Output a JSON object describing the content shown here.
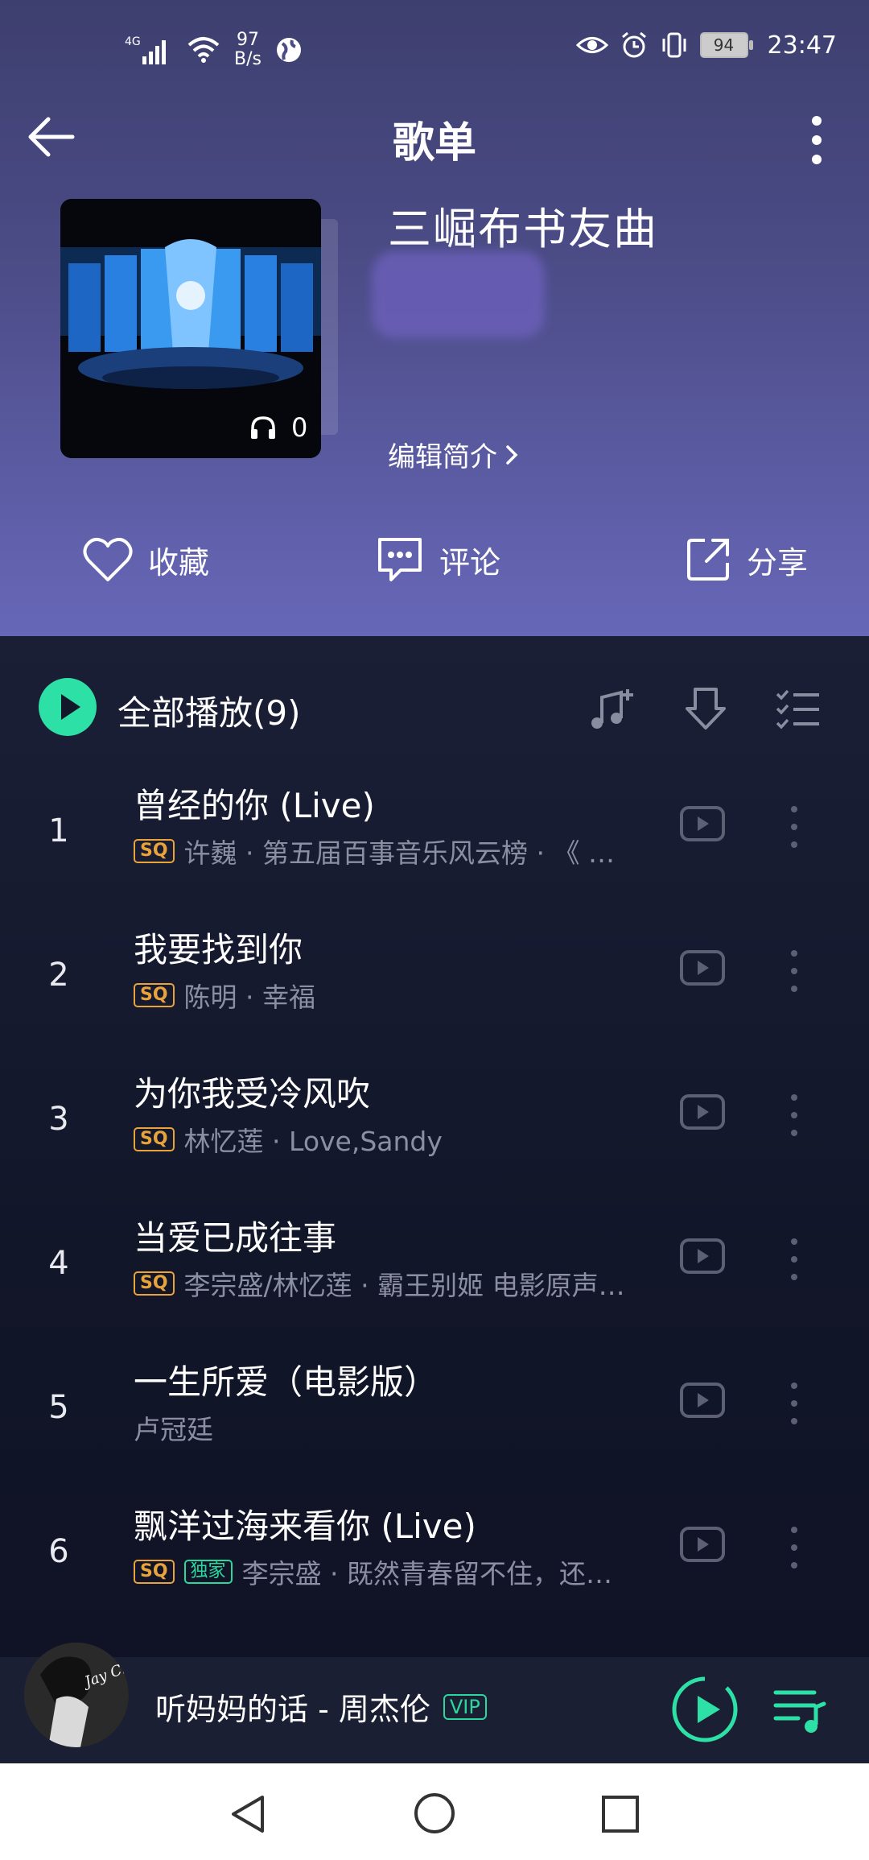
{
  "status_bar": {
    "network": "4G",
    "net_speed_value": "97",
    "net_speed_unit": "B/s",
    "battery": "94",
    "time": "23:47"
  },
  "topbar": {
    "title": "歌单"
  },
  "playlist": {
    "title": "三崛布书友曲",
    "play_count": "0",
    "edit_intro": "编辑简介"
  },
  "actions": {
    "favorite": "收藏",
    "comment": "评论",
    "share": "分享"
  },
  "play_all": {
    "label": "全部播放(9)"
  },
  "songs": [
    {
      "index": "1",
      "name": "曾经的你 (Live)",
      "sq": "SQ",
      "exclusive": "",
      "sub": "许巍 · 第五届百事音乐风云榜 · 《 …"
    },
    {
      "index": "2",
      "name": "我要找到你",
      "sq": "SQ",
      "exclusive": "",
      "sub": "陈明 · 幸福"
    },
    {
      "index": "3",
      "name": "为你我受冷风吹",
      "sq": "SQ",
      "exclusive": "",
      "sub": "林忆莲 · Love,Sandy"
    },
    {
      "index": "4",
      "name": "当爱已成往事",
      "sq": "SQ",
      "exclusive": "",
      "sub": "李宗盛/林忆莲 · 霸王别姬 电影原声…"
    },
    {
      "index": "5",
      "name": "一生所爱（电影版）",
      "sq": "",
      "exclusive": "",
      "sub": "卢冠廷"
    },
    {
      "index": "6",
      "name": "飘洋过海来看你 (Live)",
      "sq": "SQ",
      "exclusive": "独家",
      "sub": "李宗盛 · 既然青春留不住，还…"
    }
  ],
  "mini_player": {
    "title": "听妈妈的话 - 周杰伦",
    "vip": "VIP",
    "avatar_text": "Jay Chou"
  },
  "colors": {
    "accent": "#2de1a6",
    "sq_tag": "#e9a33b",
    "header_top": "#3d3f6e",
    "header_bottom": "#6767b8",
    "list_bg": "#121729"
  }
}
